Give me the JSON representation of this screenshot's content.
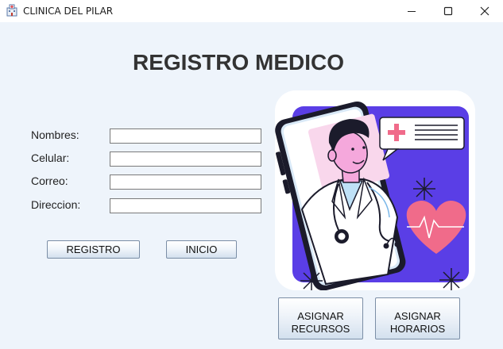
{
  "window": {
    "title": "CLINICA DEL PILAR"
  },
  "heading": "REGISTRO MEDICO",
  "form": {
    "fields": [
      {
        "label": "Nombres:",
        "value": ""
      },
      {
        "label": "Celular:",
        "value": ""
      },
      {
        "label": "Correo:",
        "value": ""
      },
      {
        "label": "Direccion:",
        "value": ""
      }
    ]
  },
  "buttons": {
    "registro": "REGISTRO",
    "inicio": "INICIO",
    "asignar_recursos": [
      "ASIGNAR",
      "RECURSOS"
    ],
    "asignar_horarios": [
      "ASIGNAR",
      "HORARIOS"
    ]
  },
  "illustration": {
    "icons": [
      "doctor-icon",
      "phone-icon",
      "medical-cross-icon",
      "heart-icon",
      "stethoscope-icon",
      "sparkle-icon"
    ],
    "colors": {
      "panel": "#5a3ee6",
      "heart": "#f06b8a",
      "cross": "#f06b8a",
      "skin": "#f5a8dc"
    }
  }
}
